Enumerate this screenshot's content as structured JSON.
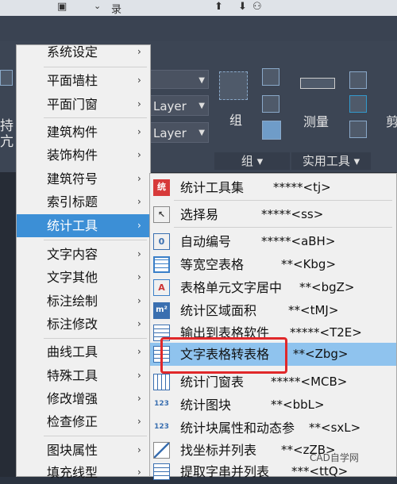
{
  "title_fragment": "录",
  "ribbon": {
    "layer_1": "Layer",
    "layer_2": "Layer",
    "group_label": "组",
    "measure_label": "测量",
    "cut_label": "剪",
    "panel_group": "组 ▾",
    "panel_utils": "实用工具 ▾",
    "left_text_1": "持",
    "left_text_2": "亢"
  },
  "main_menu": {
    "items": [
      {
        "label": "系统设定"
      },
      {
        "label": "平面墙柱"
      },
      {
        "label": "平面门窗"
      },
      {
        "label": "建筑构件"
      },
      {
        "label": "装饰构件"
      },
      {
        "label": "建筑符号"
      },
      {
        "label": "索引标题"
      },
      {
        "label": "统计工具"
      },
      {
        "label": "文字内容"
      },
      {
        "label": "文字其他"
      },
      {
        "label": "标注绘制"
      },
      {
        "label": "标注修改"
      },
      {
        "label": "曲线工具"
      },
      {
        "label": "特殊工具"
      },
      {
        "label": "修改增强"
      },
      {
        "label": "检查修正"
      },
      {
        "label": "图块属性"
      },
      {
        "label": "填充线型"
      }
    ],
    "arrow": "›"
  },
  "sub_menu": {
    "items": [
      {
        "label": "统计工具集",
        "shortcut": "*****<tj>",
        "icon": "统"
      },
      {
        "label": "选择易",
        "shortcut": "*****<ss>",
        "icon": "↖"
      },
      {
        "label": "自动编号",
        "shortcut": "*****<aBH>",
        "icon": "0"
      },
      {
        "label": "等宽空表格",
        "shortcut": "**<Kbg>",
        "icon": ""
      },
      {
        "label": "表格单元文字居中",
        "shortcut": "**<bgZ>",
        "icon": "A"
      },
      {
        "label": "统计区域面积",
        "shortcut": "**<tMJ>",
        "icon": "m²"
      },
      {
        "label": "输出到表格软件",
        "shortcut": "*****<T2E>",
        "icon": ""
      },
      {
        "label": "文字表格转表格",
        "shortcut": "**<Zbg>",
        "icon": ""
      },
      {
        "label": "统计门窗表",
        "shortcut": "*****<MCB>",
        "icon": ""
      },
      {
        "label": "统计图块",
        "shortcut": "**<bbL>",
        "icon": "123"
      },
      {
        "label": "统计块属性和动态参",
        "shortcut": "**<sxL>",
        "icon": "123"
      },
      {
        "label": "找坐标并列表",
        "shortcut": "**<zZB>",
        "icon": ""
      },
      {
        "label": "提取字串并列表",
        "shortcut": "***<ttQ>",
        "icon": ""
      }
    ],
    "arrow": "›"
  },
  "watermark": "CAD自学网",
  "colors": {
    "selection": "#3c8fd6",
    "highlight_box": "#e0282a",
    "sub_selection": "#8fc3ee"
  }
}
